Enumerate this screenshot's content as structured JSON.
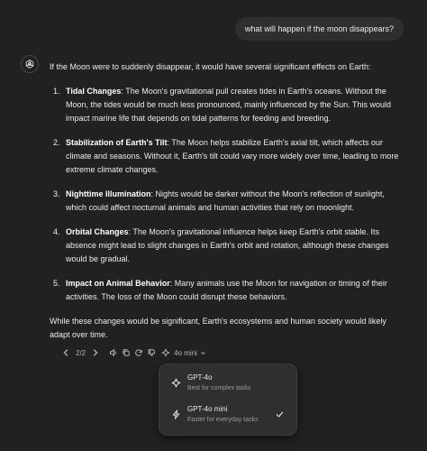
{
  "user_message": "what will happen if the moon disappears?",
  "assistant": {
    "icon": "openai-logo-icon",
    "intro": "If the Moon were to suddenly disappear, it would have several significant effects on Earth:",
    "items": [
      {
        "num": "1.",
        "title": "Tidal Changes",
        "text": ": The Moon's gravitational pull creates tides in Earth's oceans. Without the Moon, the tides would be much less pronounced, mainly influenced by the Sun. This would impact marine life that depends on tidal patterns for feeding and breeding."
      },
      {
        "num": "2.",
        "title": "Stabilization of Earth's Tilt",
        "text": ": The Moon helps stabilize Earth's axial tilt, which affects our climate and seasons. Without it, Earth's tilt could vary more widely over time, leading to more extreme climate changes."
      },
      {
        "num": "3.",
        "title": "Nighttime Illumination",
        "text": ": Nights would be darker without the Moon's reflection of sunlight, which could affect nocturnal animals and human activities that rely on moonlight."
      },
      {
        "num": "4.",
        "title": "Orbital Changes",
        "text": ": The Moon's gravitational influence helps keep Earth's orbit stable. Its absence might lead to slight changes in Earth's orbit and rotation, although these changes would be gradual."
      },
      {
        "num": "5.",
        "title": "Impact on Animal Behavior",
        "text": ": Many animals use the Moon for navigation or timing of their activities. The loss of the Moon could disrupt these behaviors."
      }
    ],
    "outro": "While these changes would be significant, Earth's ecosystems and human society would likely adapt over time."
  },
  "toolbar": {
    "pager": "2/2",
    "model_label": "4o mini",
    "icons": [
      "chevron-left-icon",
      "chevron-right-icon",
      "speaker-icon",
      "copy-icon",
      "regenerate-icon",
      "thumbs-down-icon",
      "sparkle-icon",
      "chevron-down-icon"
    ]
  },
  "model_menu": {
    "items": [
      {
        "title": "GPT-4o",
        "subtitle": "Best for complex tasks",
        "icon": "sparkle-icon",
        "selected": false
      },
      {
        "title": "GPT-4o mini",
        "subtitle": "Faster for everyday tasks",
        "icon": "lightning-icon",
        "selected": true
      }
    ]
  },
  "colors": {
    "background": "#212121",
    "bubble": "#2f2f2f",
    "text": "#ececec",
    "muted": "#b4b4b4"
  }
}
